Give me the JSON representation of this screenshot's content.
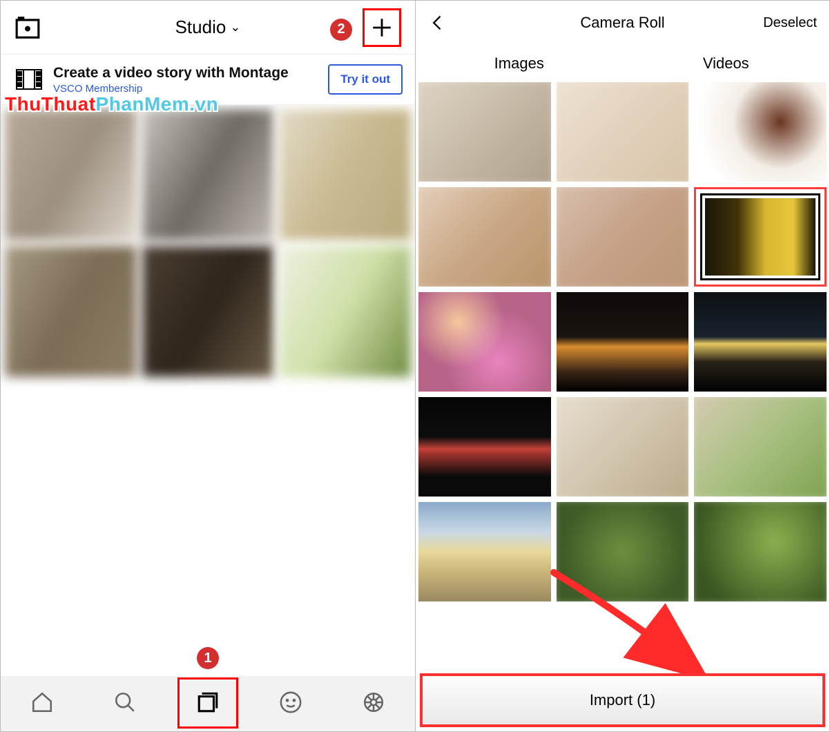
{
  "left": {
    "header_title": "Studio",
    "promo_title": "Create a video story with Montage",
    "promo_sub": "VSCO Membership",
    "try_label": "Try it out",
    "callout_add": "2",
    "callout_nav": "1",
    "nav": {
      "home": "home-icon",
      "search": "search-icon",
      "studio": "studio-icon",
      "face": "smile-icon",
      "settings": "settings-icon"
    }
  },
  "right": {
    "title": "Camera Roll",
    "deselect": "Deselect",
    "tab_images": "Images",
    "tab_videos": "Videos",
    "import_label": "Import (1)"
  },
  "watermark": {
    "part1": "ThuThuat",
    "part2": "PhanMem.vn"
  }
}
